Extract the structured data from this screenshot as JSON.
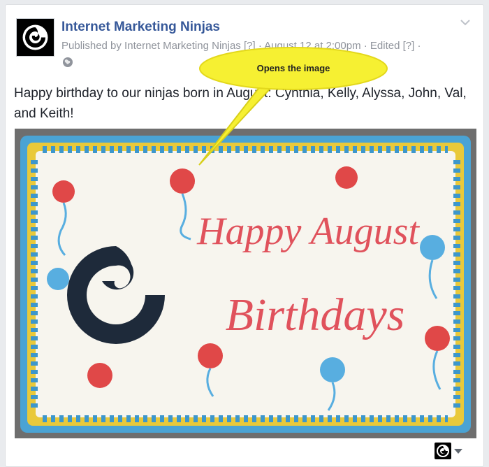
{
  "post": {
    "page_name": "Internet Marketing Ninjas",
    "meta": "Published by Internet Marketing Ninjas [?] · August 12 at 2:00pm · Edited [?] ·",
    "text": "Happy birthday to our ninjas born in August: Cynthia, Kelly, Alyssa, John, Val, and Keith!",
    "icons": {
      "avatar": "ninja-swirl-logo-icon",
      "privacy": "globe-icon",
      "options": "chevron-down-icon",
      "footer_avatar": "ninja-swirl-logo-icon",
      "footer_caret": "caret-down-icon"
    }
  },
  "photo": {
    "cake_text_line1": "Happy August",
    "cake_text_line2": "Birthdays"
  },
  "annotation": {
    "label": "Opens the image",
    "color": "#f6f032"
  }
}
